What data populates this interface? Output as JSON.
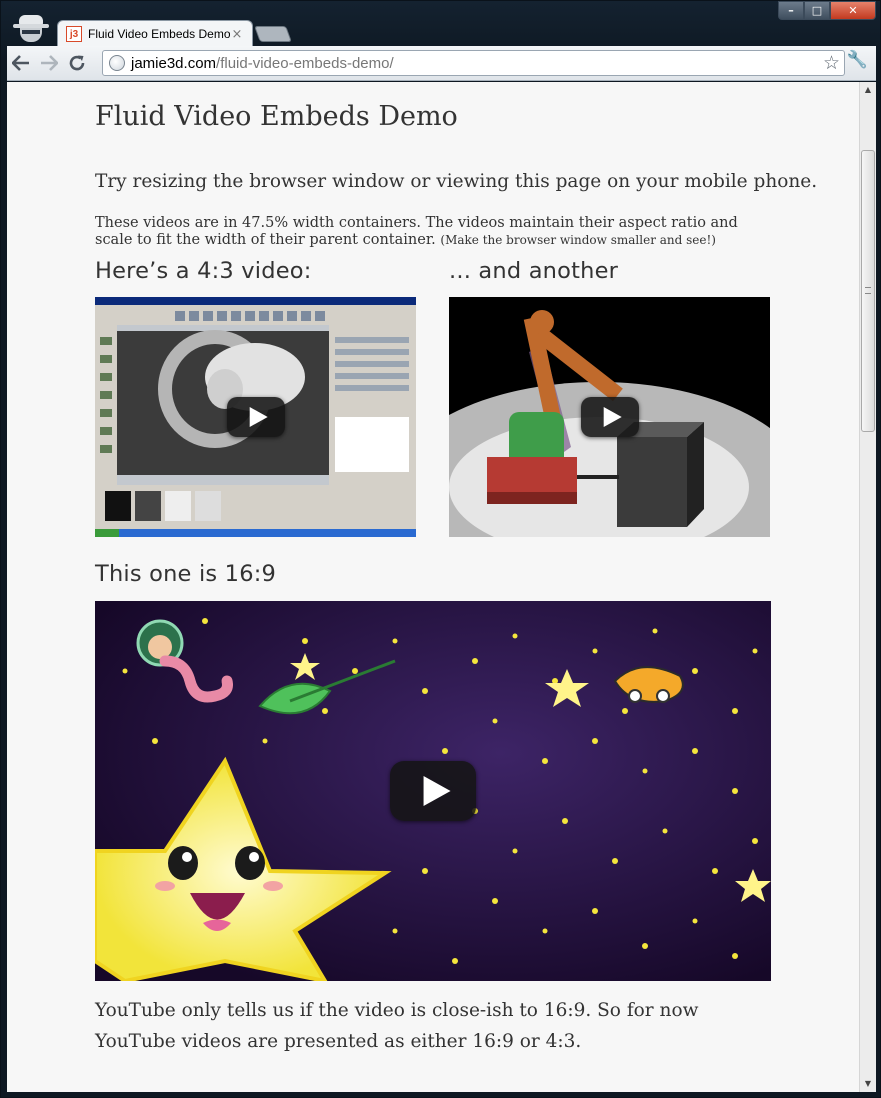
{
  "browser": {
    "tab_title": "Fluid Video Embeds Demo",
    "tab_close": "×",
    "favicon_text": "j3",
    "url_host": "jamie3d.com",
    "url_path": "/fluid-video-embeds-demo/",
    "window_buttons": {
      "minimize": "–",
      "maximize": "□",
      "close": "✕"
    }
  },
  "page": {
    "title": "Fluid Video Embeds Demo",
    "lead": "Try resizing the browser window or viewing this page on your mobile phone.",
    "description": "These videos are in 47.5% width containers. The videos maintain their aspect ratio and scale to fit the width of their parent container.",
    "description_note": "(Make the browser window smaller and see!)",
    "heading_left": "Here’s a 4:3 video:",
    "heading_right": "... and another",
    "heading_wide": "This one is 16:9",
    "footer_text": "YouTube only tells us if the video is close-ish to 16:9. So for now YouTube videos are presented as either 16:9 or 4:3."
  },
  "colors": {
    "page_background": "#f7f7f7",
    "text": "#333333",
    "video_starfield": "#1c0c33"
  }
}
